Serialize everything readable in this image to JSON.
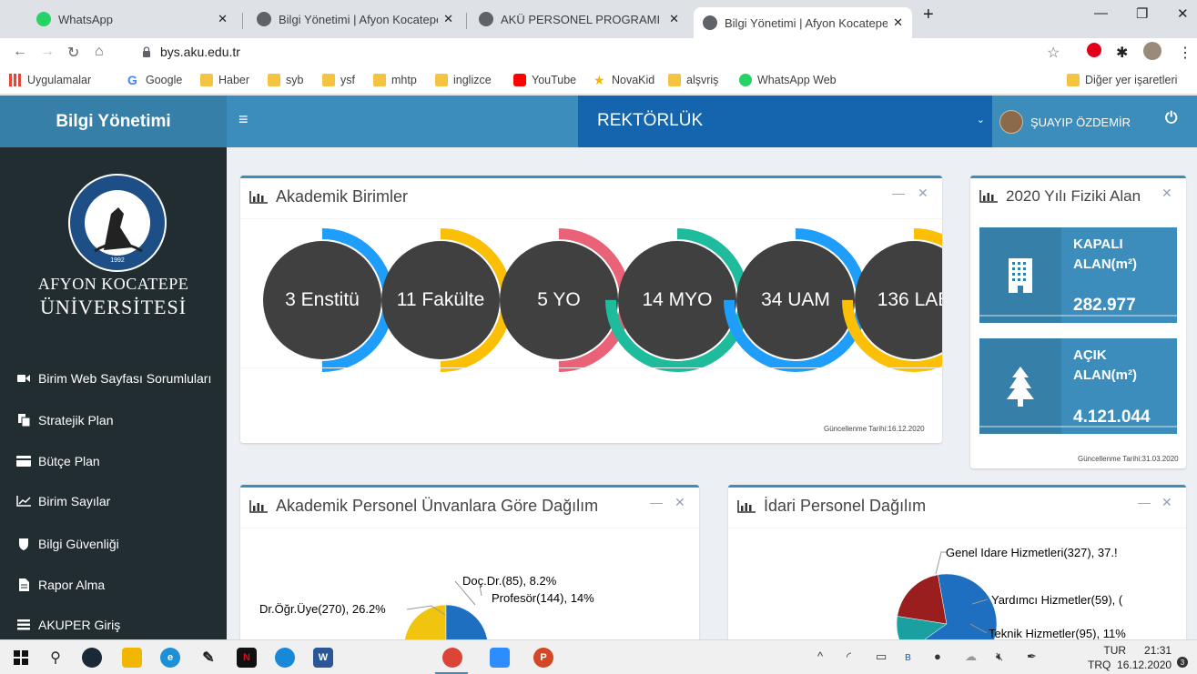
{
  "browser": {
    "tabs": [
      {
        "title": "WhatsApp",
        "icon": "whatsapp-icon",
        "active": false
      },
      {
        "title": "Bilgi Yönetimi | Afyon Kocatepe Ü",
        "icon": "globe-icon",
        "active": false
      },
      {
        "title": "AKÜ PERSONEL PROGRAMI",
        "icon": "globe-icon",
        "active": false
      },
      {
        "title": "Bilgi Yönetimi | Afyon Kocatepe Ü",
        "icon": "globe-icon",
        "active": true
      }
    ],
    "new_tab": "+",
    "url": "bys.aku.edu.tr",
    "bookmarks": [
      {
        "label": "Uygulamalar",
        "icon": "apps-grid-icon"
      },
      {
        "label": "Google",
        "icon": "google-icon"
      },
      {
        "label": "Haber",
        "icon": "folder-icon"
      },
      {
        "label": "syb",
        "icon": "folder-icon"
      },
      {
        "label": "ysf",
        "icon": "folder-icon"
      },
      {
        "label": "mhtp",
        "icon": "folder-icon"
      },
      {
        "label": "inglizce",
        "icon": "folder-icon"
      },
      {
        "label": "YouTube",
        "icon": "youtube-icon"
      },
      {
        "label": "NovaKid",
        "icon": "star-icon"
      },
      {
        "label": "alşvriş",
        "icon": "folder-icon"
      },
      {
        "label": "WhatsApp Web",
        "icon": "whatsapp-icon"
      }
    ],
    "other_bookmarks": "Diğer yer işaretleri"
  },
  "header": {
    "brand": "Bilgi Yönetimi",
    "menu_icon": "≡",
    "unit": "REKTÖRLÜK",
    "user_name": "ŞUAYIP ÖZDEMİR"
  },
  "sidebar": {
    "university_line1": "AFYON KOCATEPE",
    "university_line2": "ÜNİVERSİTESİ",
    "logo_text_top": "AFYON KOCATEPE ÜNİVERSİTESİ",
    "logo_year": "1992",
    "items": [
      {
        "label": "Birim Web Sayfası Sorumluları",
        "icon": "video-camera-icon"
      },
      {
        "label": "Stratejik Plan",
        "icon": "copy-document-icon"
      },
      {
        "label": "Bütçe Plan",
        "icon": "credit-card-icon"
      },
      {
        "label": "Birim Sayılar",
        "icon": "line-chart-icon"
      },
      {
        "label": "Bilgi Güvenliği",
        "icon": "shield-icon"
      },
      {
        "label": "Rapor Alma",
        "icon": "file-icon"
      },
      {
        "label": "AKUPER Giriş",
        "icon": "list-icon"
      }
    ]
  },
  "academic_units": {
    "title": "Akademik Birimler",
    "updated": "Güncellenme Tarihi:16.12.2020",
    "rings": [
      {
        "label": "3 Enstitü",
        "color": "#1e9dfa",
        "fraction": 0.5
      },
      {
        "label": "11 Fakülte",
        "color": "#fbbf06",
        "fraction": 0.5
      },
      {
        "label": "5 YO",
        "color": "#ea6277",
        "fraction": 0.5
      },
      {
        "label": "14 MYO",
        "color": "#1ebc9c",
        "fraction": 0.75
      },
      {
        "label": "34 UAM",
        "color": "#1e9dfa",
        "fraction": 0.75
      },
      {
        "label": "136 LAB",
        "color": "#fbbf06",
        "fraction": 0.75
      }
    ]
  },
  "physical_area": {
    "title": "2020 Yılı Fiziki Alan",
    "closed": {
      "label_line1": "KAPALI",
      "label_line2": "ALAN(m²)",
      "value": "282.977",
      "icon": "building-icon"
    },
    "open": {
      "label_line1": "AÇIK",
      "label_line2": "ALAN(m²)",
      "value": "4.121.044",
      "icon": "tree-icon"
    },
    "updated": "Güncellenme Tarihi:31.03.2020"
  },
  "academic_staff": {
    "title": "Akademik Personel Ünvanlara Göre Dağılım",
    "labels": [
      {
        "text": "Doç.Dr.(85), 8.2%",
        "color": "#10a630"
      },
      {
        "text": "Profesör(144), 14%",
        "color": "#1f7ac4"
      },
      {
        "text": "Dr.Öğr.Üye(270), 26.2%",
        "color": "#d6b400"
      }
    ]
  },
  "admin_staff": {
    "title": "İdari Personel Dağılım",
    "labels": [
      {
        "text": "Genel Idare Hizmetleri(327), 37.!",
        "color": "#1f7ac4"
      },
      {
        "text": "Yardımcı Hizmetler(59), (",
        "color": "#10a630"
      },
      {
        "text": "Teknik Hizmetler(95), 11%",
        "color": "#9b1e1e"
      }
    ]
  },
  "chart_data": [
    {
      "type": "pie",
      "title": "Akademik Personel Ünvanlara Göre Dağılım",
      "categories": [
        "Profesör",
        "Doç.Dr.",
        "Dr.Öğr.Üye"
      ],
      "values": [
        144,
        85,
        270
      ],
      "percent": [
        14,
        8.2,
        26.2
      ],
      "colors": [
        "#1e6fbf",
        "#1aa83a",
        "#f1c40f"
      ]
    },
    {
      "type": "pie",
      "title": "İdari Personel Dağılım",
      "categories": [
        "Genel Idare Hizmetleri",
        "Yardımcı Hizmetler",
        "Teknik Hizmetler"
      ],
      "values": [
        327,
        59,
        95
      ],
      "percent_printed": [
        "37.!",
        "(",
        "11%"
      ],
      "colors": [
        "#1e6fbf",
        "#1aa0a0",
        "#9b1e1e"
      ]
    }
  ],
  "taskbar": {
    "lang_line1": "TUR",
    "lang_line2": "TRQ",
    "time": "21:31",
    "date": "16.12.2020",
    "notifications": "3"
  }
}
